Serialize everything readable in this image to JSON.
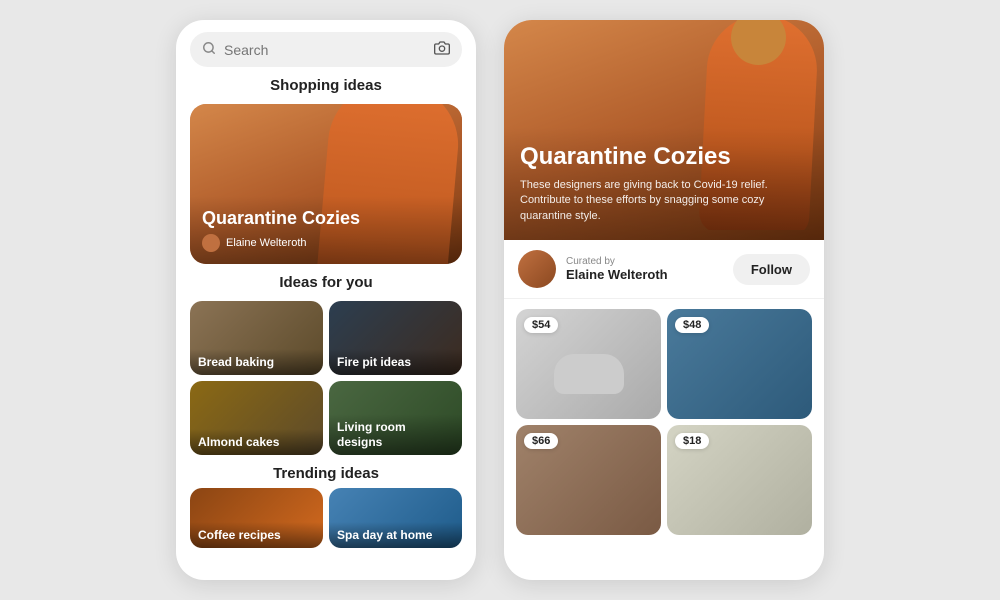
{
  "left_phone": {
    "search_placeholder": "Search",
    "shopping_section": "Shopping ideas",
    "hero_title": "Quarantine Cozies",
    "hero_author": "Elaine Welteroth",
    "ideas_section": "Ideas for you",
    "ideas": [
      {
        "label": "Bread baking",
        "bg": "bg-bread"
      },
      {
        "label": "Fire pit ideas",
        "bg": "bg-firepit"
      },
      {
        "label": "Almond cakes",
        "bg": "bg-almond"
      },
      {
        "label": "Living room designs",
        "bg": "bg-livingroom"
      }
    ],
    "trending_section": "Trending ideas",
    "trending": [
      {
        "label": "Coffee recipes",
        "bg": "bg-coffee"
      },
      {
        "label": "Spa day at home",
        "bg": "bg-spa"
      }
    ]
  },
  "right_phone": {
    "hero_title": "Quarantine Cozies",
    "hero_desc": "These designers are giving back to Covid-19 relief. Contribute to these efforts by snagging some cozy quarantine style.",
    "curator_by": "Curated by",
    "curator_name": "Elaine Welteroth",
    "follow_label": "Follow",
    "products": [
      {
        "price": "$54",
        "bg": "product-bg-slippers"
      },
      {
        "price": "$48",
        "bg": "product-bg-leggings"
      },
      {
        "price": "$66",
        "bg": "product-bg-hoodie"
      },
      {
        "price": "$18",
        "bg": "product-bg-socks"
      }
    ]
  },
  "icons": {
    "search": "🔍",
    "camera": "📷"
  }
}
